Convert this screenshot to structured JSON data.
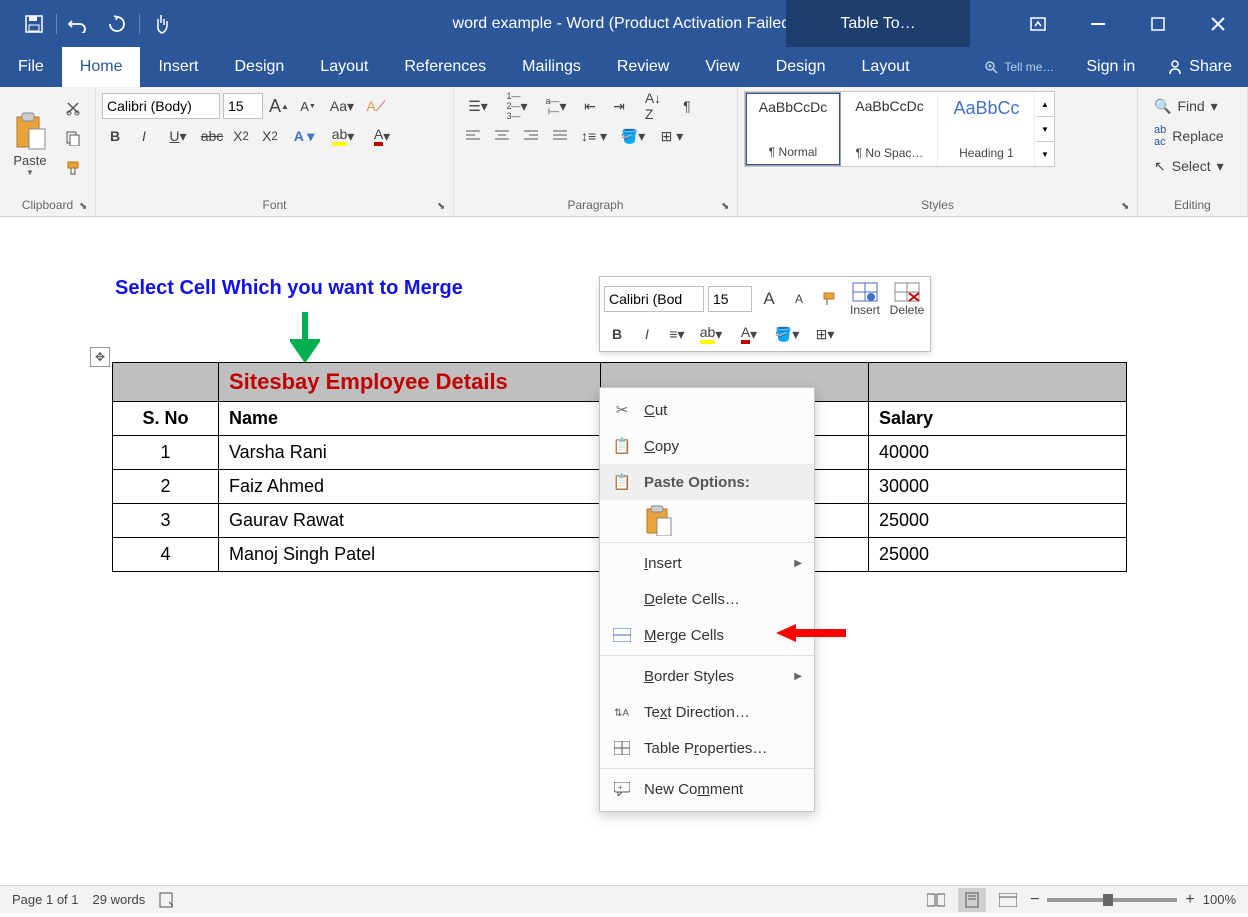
{
  "title": "word example - Word (Product Activation Failed)",
  "table_tools_label": "Table To…",
  "tabs": [
    "File",
    "Home",
    "Insert",
    "Design",
    "Layout",
    "References",
    "Mailings",
    "Review",
    "View"
  ],
  "context_tabs": [
    "Design",
    "Layout"
  ],
  "tellme": "Tell me…",
  "signin": "Sign in",
  "share": "Share",
  "ribbon": {
    "clipboard": {
      "label": "Clipboard",
      "paste": "Paste"
    },
    "font": {
      "label": "Font",
      "name": "Calibri (Body)",
      "size": "15"
    },
    "paragraph": {
      "label": "Paragraph"
    },
    "styles": {
      "label": "Styles",
      "items": [
        {
          "preview": "AaBbCcDc",
          "name": "¶ Normal",
          "selected": true
        },
        {
          "preview": "AaBbCcDc",
          "name": "¶ No Spac…"
        },
        {
          "preview": "AaBbCc",
          "name": "Heading 1",
          "heading": true
        }
      ]
    },
    "editing": {
      "label": "Editing",
      "find": "Find",
      "replace": "Replace",
      "select": "Select"
    }
  },
  "instruction": "Select Cell Which you want to Merge",
  "table": {
    "title": "Sitesbay Employee Details",
    "headers": [
      "S. No",
      "Name",
      "",
      "Salary"
    ],
    "rows": [
      {
        "sno": "1",
        "name": "Varsha Rani",
        "salary": "40000"
      },
      {
        "sno": "2",
        "name": "Faiz Ahmed",
        "salary": "30000"
      },
      {
        "sno": "3",
        "name": "Gaurav Rawat",
        "salary": "25000"
      },
      {
        "sno": "4",
        "name": "Manoj Singh Patel",
        "salary": "25000"
      }
    ]
  },
  "minitoolbar": {
    "font": "Calibri (Bod",
    "size": "15",
    "insert": "Insert",
    "delete": "Delete"
  },
  "ctxmenu": {
    "cut": "Cut",
    "copy": "Copy",
    "paste_options": "Paste Options:",
    "insert": "Insert",
    "delete_cells": "Delete Cells…",
    "merge": "Merge Cells",
    "border_styles": "Border Styles",
    "text_direction": "Text Direction…",
    "table_props": "Table Properties…",
    "new_comment": "New Comment"
  },
  "status": {
    "page": "Page 1 of 1",
    "words": "29 words",
    "zoom": "100%"
  }
}
